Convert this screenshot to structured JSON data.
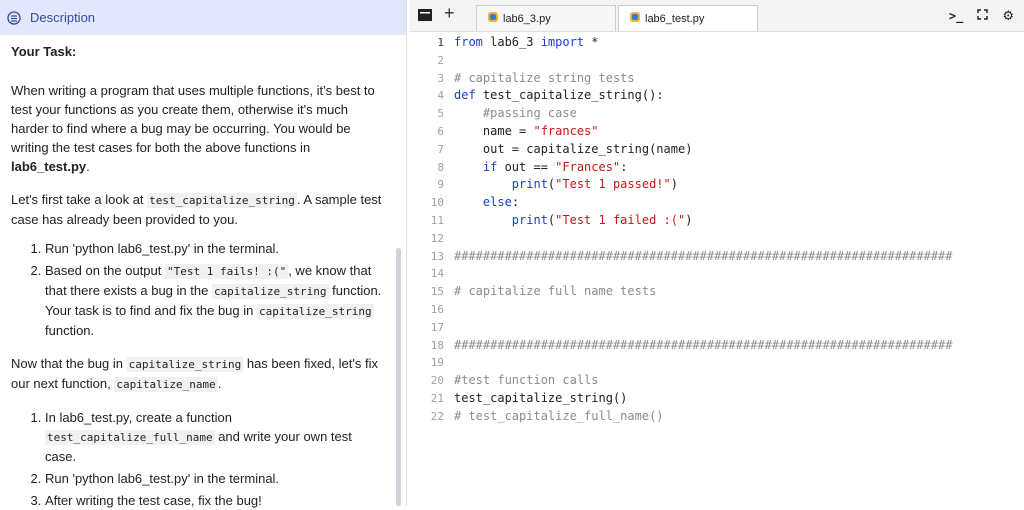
{
  "description": {
    "tab_label": "Description",
    "heading": "Your Task:",
    "p1_a": "When writing a program that uses multiple functions, it's best to test your functions as you create them, otherwise it's much harder to find where a bug may be occurring. You would be writing the test cases for both the above functions in ",
    "p1_b": "lab6_test.py",
    "p1_c": ".",
    "p2_a": "Let's first take a look at ",
    "p2_code": "test_capitalize_string",
    "p2_b": ". A sample test case has already been provided to you.",
    "list1": {
      "item1": "Run 'python lab6_test.py' in the terminal.",
      "item2_a": "Based on the output ",
      "item2_code1": "\"Test 1 fails! :(\"",
      "item2_b": ", we know that that there exists a bug in the ",
      "item2_code2": "capitalize_string",
      "item2_c": " function. Your task is to find and fix the bug in ",
      "item2_code3": "capitalize_string",
      "item2_d": " function."
    },
    "p3_a": "Now that the bug in ",
    "p3_code1": "capitalize_string",
    "p3_b": " has been fixed, let's fix our next function, ",
    "p3_code2": "capitalize_name",
    "p3_c": ".",
    "list2": {
      "item1_a": "In lab6_test.py, create a function ",
      "item1_code": "test_capitalize_full_name",
      "item1_b": " and write your own test case.",
      "item2": "Run 'python lab6_test.py' in the terminal.",
      "item3": "After writing the test case, fix the bug!"
    }
  },
  "editor": {
    "tabs": [
      {
        "label": "lab6_3.py"
      },
      {
        "label": "lab6_test.py"
      }
    ],
    "lines": [
      {
        "n": "1",
        "parts": [
          [
            "kw",
            "from"
          ],
          [
            "tx",
            " lab6_3 "
          ],
          [
            "kw",
            "import"
          ],
          [
            "tx",
            " *"
          ]
        ]
      },
      {
        "n": "2",
        "parts": []
      },
      {
        "n": "3",
        "parts": [
          [
            "cm",
            "# capitalize string tests"
          ]
        ]
      },
      {
        "n": "4",
        "parts": [
          [
            "kw",
            "def"
          ],
          [
            "tx",
            " test_capitalize_string():"
          ]
        ]
      },
      {
        "n": "5",
        "parts": [
          [
            "cm",
            "    #passing case"
          ]
        ]
      },
      {
        "n": "6",
        "parts": [
          [
            "tx",
            "    name = "
          ],
          [
            "str",
            "\"frances\""
          ]
        ]
      },
      {
        "n": "7",
        "parts": [
          [
            "tx",
            "    out = capitalize_string(name)"
          ]
        ]
      },
      {
        "n": "8",
        "parts": [
          [
            "tx",
            "    "
          ],
          [
            "kw",
            "if"
          ],
          [
            "tx",
            " out == "
          ],
          [
            "str",
            "\"Frances\""
          ],
          [
            "tx",
            ":"
          ]
        ]
      },
      {
        "n": "9",
        "parts": [
          [
            "tx",
            "        "
          ],
          [
            "kw",
            "print"
          ],
          [
            "tx",
            "("
          ],
          [
            "str",
            "\"Test 1 passed!\""
          ],
          [
            "tx",
            ")"
          ]
        ]
      },
      {
        "n": "10",
        "parts": [
          [
            "tx",
            "    "
          ],
          [
            "kw",
            "else"
          ],
          [
            "tx",
            ":"
          ]
        ]
      },
      {
        "n": "11",
        "parts": [
          [
            "tx",
            "        "
          ],
          [
            "kw",
            "print"
          ],
          [
            "tx",
            "("
          ],
          [
            "str",
            "\"Test 1 failed :(\""
          ],
          [
            "tx",
            ")"
          ]
        ]
      },
      {
        "n": "12",
        "parts": []
      },
      {
        "n": "13",
        "parts": [
          [
            "cm",
            "#####################################################################"
          ]
        ]
      },
      {
        "n": "14",
        "parts": []
      },
      {
        "n": "15",
        "parts": [
          [
            "cm",
            "# capitalize full name tests"
          ]
        ]
      },
      {
        "n": "16",
        "parts": []
      },
      {
        "n": "17",
        "parts": []
      },
      {
        "n": "18",
        "parts": [
          [
            "cm",
            "#####################################################################"
          ]
        ]
      },
      {
        "n": "19",
        "parts": []
      },
      {
        "n": "20",
        "parts": [
          [
            "cm",
            "#test function calls"
          ]
        ]
      },
      {
        "n": "21",
        "parts": [
          [
            "tx",
            "test_capitalize_string()"
          ]
        ]
      },
      {
        "n": "22",
        "parts": [
          [
            "cm",
            "# test_capitalize_full_name()"
          ]
        ]
      }
    ]
  },
  "icons": {
    "menu": "menu-icon",
    "add_tab": "plus-icon",
    "python": "python-file-icon",
    "terminal": "terminal-icon",
    "fullscreen": "fullscreen-icon",
    "settings": "gear-icon"
  }
}
